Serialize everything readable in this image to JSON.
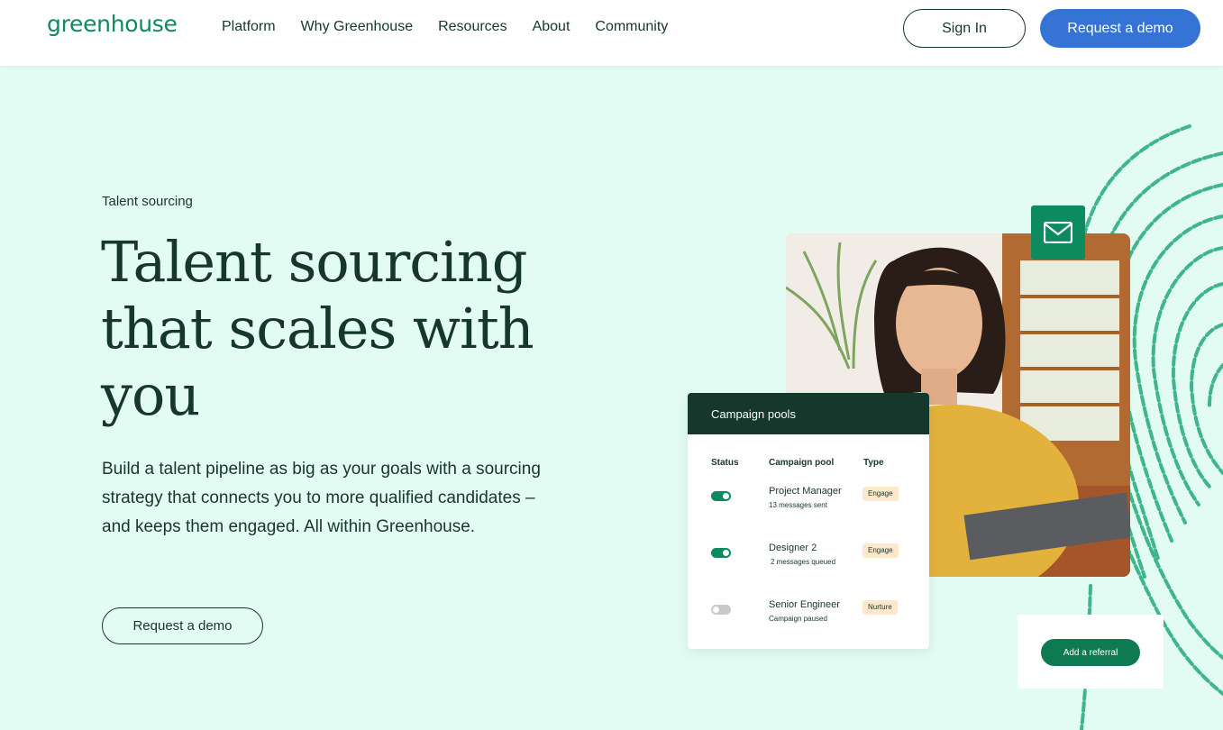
{
  "header": {
    "logo": "greenhouse",
    "nav": [
      "Platform",
      "Why Greenhouse",
      "Resources",
      "About",
      "Community"
    ],
    "sign_in": "Sign In",
    "request_demo": "Request a demo"
  },
  "hero": {
    "eyebrow": "Talent sourcing",
    "headline": "Talent sourcing that scales with you",
    "description": "Build a talent pipeline as big as your goals with a sourcing strategy that connects you to more qualified candidates – and keeps them engaged. All within Greenhouse.",
    "cta": "Request a demo"
  },
  "campaign_card": {
    "title": "Campaign pools",
    "columns": [
      "Status",
      "Campaign pool",
      "Type"
    ],
    "rows": [
      {
        "status": "on",
        "name": "Project Manager",
        "sub": "13 messages sent",
        "type": "Engage"
      },
      {
        "status": "on",
        "name": "Designer 2",
        "sub": "2 messages queued",
        "type": "Engage"
      },
      {
        "status": "off",
        "name": "Senior Engineer",
        "sub": "Campaign paused",
        "type": "Nurture"
      }
    ]
  },
  "referral": {
    "button": "Add a referral"
  },
  "colors": {
    "brand_green": "#0e8a5f",
    "dark_green": "#15372c",
    "hero_bg": "#e2fcf4",
    "demo_blue": "#3574d4",
    "badge_bg": "#fde8cc"
  },
  "icons": [
    "mail-icon",
    "fingerprint-graphic",
    "toggle-on-icon",
    "toggle-off-icon"
  ]
}
